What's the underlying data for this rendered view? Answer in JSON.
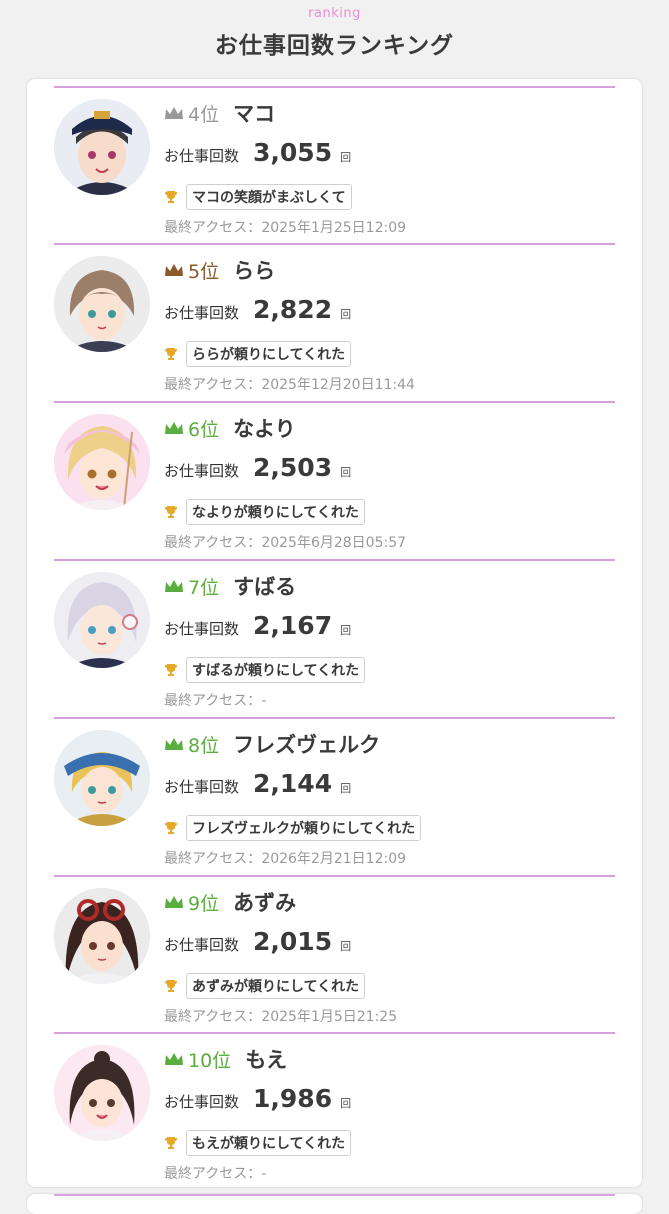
{
  "header": {
    "sub": "ranking",
    "title": "お仕事回数ランキング"
  },
  "labels": {
    "job": "お仕事回数",
    "unit": "回",
    "access": "最終アクセス："
  },
  "entries": [
    {
      "rank": "4位",
      "name": "マコ",
      "count": "3,055",
      "badge": "マコの笑顔がまぶしくて",
      "access": "2025年1月25日12:09",
      "rank_color": "#999999"
    },
    {
      "rank": "5位",
      "name": "らら",
      "count": "2,822",
      "badge": "ららが頼りにしてくれた",
      "access": "2025年12月20日11:44",
      "rank_color": "#8b5a2b"
    },
    {
      "rank": "6位",
      "name": "なより",
      "count": "2,503",
      "badge": "なよりが頼りにしてくれた",
      "access": "2025年6月28日05:57",
      "rank_color": "#5aae3e"
    },
    {
      "rank": "7位",
      "name": "すばる",
      "count": "2,167",
      "badge": "すばるが頼りにしてくれた",
      "access": "-",
      "rank_color": "#5aae3e"
    },
    {
      "rank": "8位",
      "name": "フレズヴェルク",
      "count": "2,144",
      "badge": "フレズヴェルクが頼りにしてくれた",
      "access": "2026年2月21日12:09",
      "rank_color": "#5aae3e"
    },
    {
      "rank": "9位",
      "name": "あずみ",
      "count": "2,015",
      "badge": "あずみが頼りにしてくれた",
      "access": "2025年1月5日21:25",
      "rank_color": "#5aae3e"
    },
    {
      "rank": "10位",
      "name": "もえ",
      "count": "1,986",
      "badge": "もえが頼りにしてくれた",
      "access": "-",
      "rank_color": "#5aae3e"
    }
  ],
  "icons": {
    "crown": "crown-icon",
    "trophy": "trophy-icon",
    "avatar": "avatar"
  },
  "colors": {
    "accent_pink": "#e88fd3",
    "divider": "#d7a0dc",
    "trophy": "#e7a92a"
  }
}
